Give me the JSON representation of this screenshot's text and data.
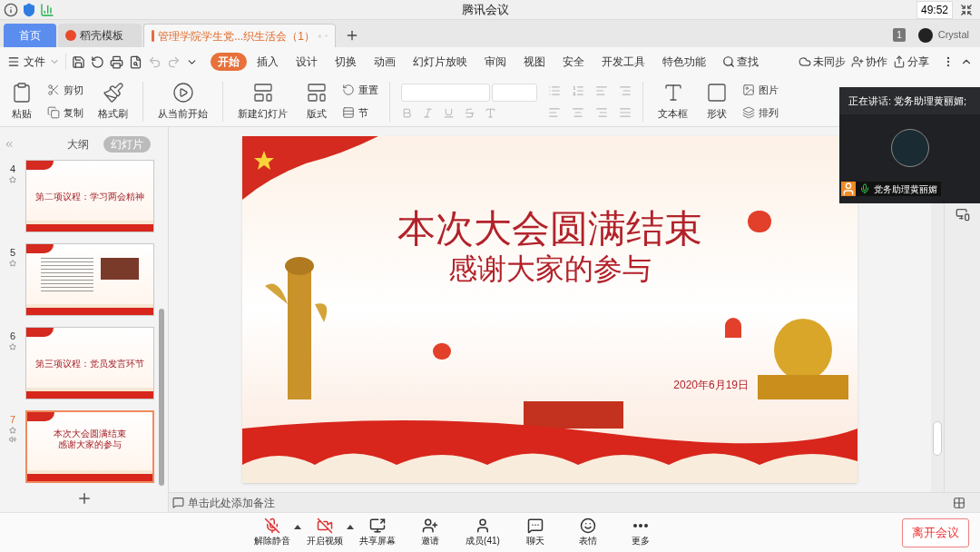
{
  "meeting_bar": {
    "title": "腾讯会议",
    "timer": "49:52"
  },
  "doc_tabs": [
    {
      "label": "首页",
      "kind": "home",
      "selected": false
    },
    {
      "label": "稻壳模板",
      "kind": "template",
      "selected": false
    },
    {
      "label": "管理学院学生党...织生活会（1）",
      "kind": "doc",
      "selected": true
    }
  ],
  "account": {
    "badge": "1",
    "name": "Crystal"
  },
  "menu": {
    "file": "文件",
    "tabs": [
      {
        "label": "开始",
        "selected": true
      },
      {
        "label": "插入",
        "selected": false
      },
      {
        "label": "设计",
        "selected": false
      },
      {
        "label": "切换",
        "selected": false
      },
      {
        "label": "动画",
        "selected": false
      },
      {
        "label": "幻灯片放映",
        "selected": false
      },
      {
        "label": "审阅",
        "selected": false
      },
      {
        "label": "视图",
        "selected": false
      },
      {
        "label": "安全",
        "selected": false
      },
      {
        "label": "开发工具",
        "selected": false
      },
      {
        "label": "特色功能",
        "selected": false
      }
    ],
    "search": "查找",
    "actions": [
      {
        "kind": "sync",
        "label": "未同步"
      },
      {
        "kind": "collab",
        "label": "协作"
      },
      {
        "kind": "share",
        "label": "分享"
      }
    ]
  },
  "ribbon": {
    "paste": "粘贴",
    "cut": "剪切",
    "copy": "复制",
    "format_painter": "格式刷",
    "play": "从当前开始",
    "new_slide": "新建幻灯片",
    "layout": "版式",
    "reset": "重置",
    "section": "节",
    "textbox": "文本框",
    "shape": "形状",
    "picture": "图片",
    "arrange": "排列"
  },
  "panel_tabs": [
    {
      "label": "大纲",
      "selected": false
    },
    {
      "label": "幻灯片",
      "selected": true
    }
  ],
  "slides": [
    {
      "number": "4",
      "kind": "title",
      "text": "第二项议程：学习两会精神",
      "selected": false,
      "audio": false
    },
    {
      "number": "5",
      "kind": "text_image",
      "selected": false,
      "audio": false
    },
    {
      "number": "6",
      "kind": "title",
      "text": "第三项议程：党员发言环节",
      "selected": false,
      "audio": false
    },
    {
      "number": "7",
      "kind": "cover",
      "title": "本次大会圆满结束",
      "text": "感谢大家的参与",
      "selected": true,
      "audio": true
    }
  ],
  "slide": {
    "title": "本次大会圆满结束",
    "subtitle": "感谢大家的参与",
    "date": "2020年6月19日"
  },
  "notes_placeholder": "单击此处添加备注",
  "speaker": {
    "label": "正在讲话: 党务助理黄丽媚;",
    "name": "党务助理黄丽媚"
  },
  "controls": [
    {
      "kind": "mic",
      "label": "解除静音",
      "menu": true
    },
    {
      "kind": "video",
      "label": "开启视频",
      "menu": true
    },
    {
      "kind": "share",
      "label": "共享屏幕",
      "menu": false
    },
    {
      "kind": "invite",
      "label": "邀请",
      "menu": false
    },
    {
      "kind": "members",
      "label": "成员(41)",
      "menu": false
    },
    {
      "kind": "chat",
      "label": "聊天",
      "menu": false
    },
    {
      "kind": "emoji",
      "label": "表情",
      "menu": false
    },
    {
      "kind": "more",
      "label": "更多",
      "menu": false
    }
  ],
  "leave": "离开会议"
}
